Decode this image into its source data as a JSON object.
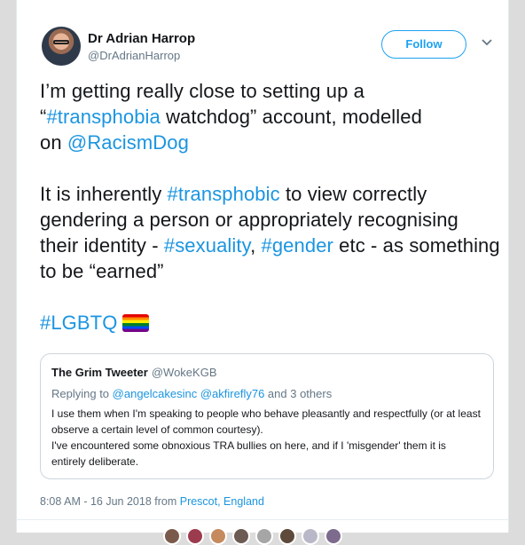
{
  "tweet": {
    "author_name": "Dr Adrian Harrop",
    "author_handle": "@DrAdrianHarrop",
    "follow_label": "Follow",
    "line1": "I’m getting really close to setting up a",
    "line2_open": "“",
    "line2_tag": "#transphobia",
    "line2_rest": " watchdog” account, modelled",
    "line3_pre": "on ",
    "line3_mention": "@RacismDog",
    "p2_pre": "It is inherently ",
    "p2_tag1": "#transphobic",
    "p2_mid1": " to view correctly gendering a person or appropriately recognising their identity - ",
    "p2_tag2": "#sexuality",
    "p2_mid2": ", ",
    "p2_tag3": "#gender",
    "p2_end": " etc - as something to be “earned”",
    "p3_tag": "#LGBTQ",
    "flag_emoji": "rainbow-flag"
  },
  "quoted": {
    "name": "The Grim Tweeter",
    "handle": "@WokeKGB",
    "replying_prefix": "Replying to ",
    "replying_user1": "@angelcakesinc",
    "replying_user2": " @akfirefly76",
    "replying_suffix": " and 3 others",
    "text1": "I use them when I'm speaking to people who behave pleasantly and respectfully (or at least observe a certain level of common courtesy).",
    "text2": "I've encountered some obnoxious TRA bullies on here, and if I 'misgender' them it is entirely deliberate."
  },
  "meta": {
    "time": "8:08 AM - 16 Jun 2018 from ",
    "location": "Prescot, England"
  },
  "colors": {
    "link": "#1b95e0",
    "follow": "#1da1f2",
    "text": "#14171a",
    "secondary": "#657786"
  }
}
